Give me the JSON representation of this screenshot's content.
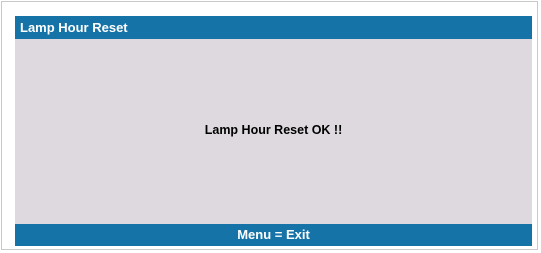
{
  "dialog": {
    "title": "Lamp Hour Reset",
    "message": "Lamp Hour Reset OK !!",
    "footer_hint": "Menu = Exit"
  },
  "colors": {
    "title_bar": "#1673a8",
    "body_background": "#ddd9de",
    "text_on_bar": "#ffffff",
    "message_text": "#000000"
  }
}
